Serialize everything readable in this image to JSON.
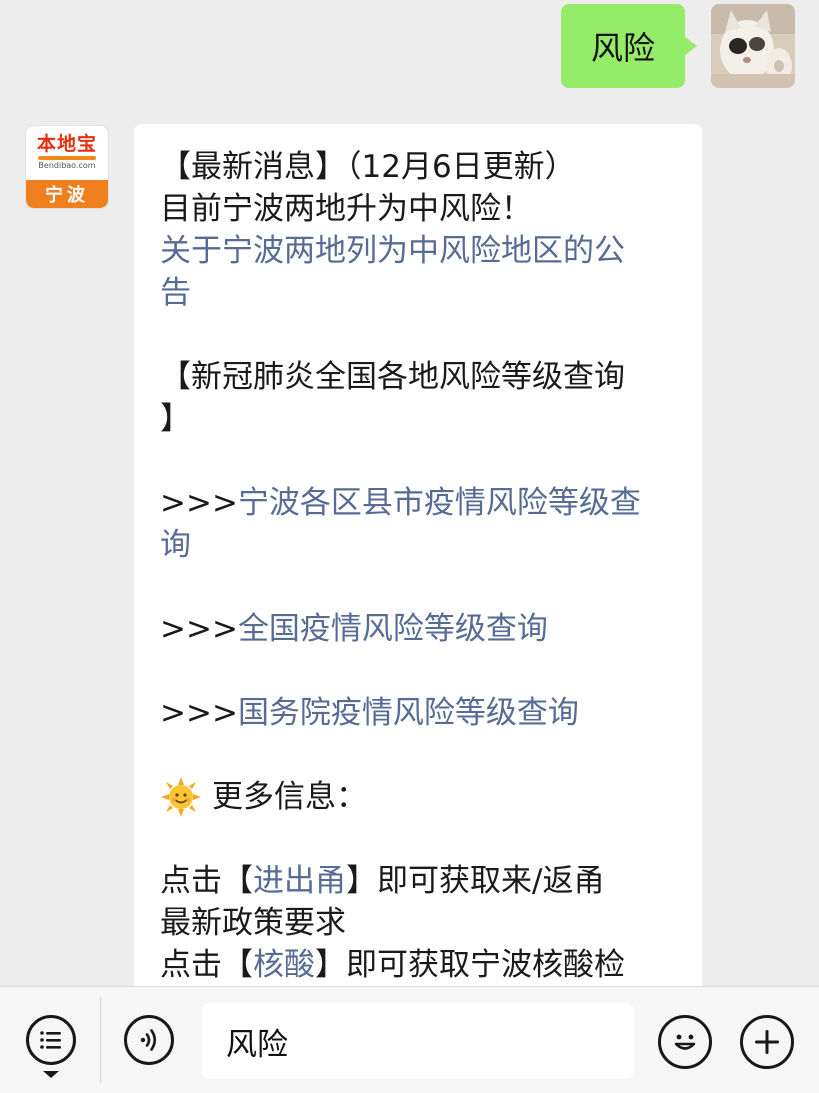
{
  "outgoing": {
    "text": "风险",
    "avatar": "cat-photo-avatar"
  },
  "incoming": {
    "avatar": {
      "name": "本地宝",
      "domain": "Bendibao.com",
      "city": "宁波"
    },
    "line1": "【最新消息】（12月6日更新）",
    "line2": "目前宁波两地升为中风险！",
    "link_notice_a": "关于宁波两地列为中风险地区的公",
    "link_notice_b": "告",
    "heading_a": "【新冠肺炎全国各地风险等级查询",
    "heading_b": "】",
    "prefix": ">>>",
    "link_ningbo_a": "宁波各区县市疫情风险等级查",
    "link_ningbo_b": "询",
    "link_national": "全国疫情风险等级查询",
    "link_state_council": "国务院疫情风险等级查询",
    "sun_icon": "sun-emoji",
    "more_info": "更多信息：",
    "click1_pre": "点击【",
    "click1_kw": "进出甬",
    "click1_post": "】即可获取来/返甬",
    "click1_line2": "最新政策要求",
    "click2_pre": "点击【",
    "click2_kw": "核酸",
    "click2_post": "】即可获取宁波核酸检",
    "link_color": "#576b95"
  },
  "input_bar": {
    "voice_icon": "voice-icon",
    "menu_icon": "menu-list-icon",
    "value": "风险",
    "emoji_icon": "emoji-icon",
    "plus_icon": "plus-icon"
  },
  "colors": {
    "outgoing_bubble": "#95ec69",
    "background": "#ededed",
    "brand_red": "#e2300f",
    "brand_orange": "#f07f1e"
  }
}
